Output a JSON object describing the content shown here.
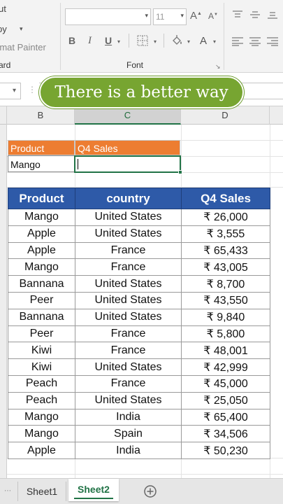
{
  "ribbon": {
    "clipboard": {
      "cut_label": "ut",
      "copy_label": "py",
      "painter_label": "rmat Painter",
      "group_label": "ard"
    },
    "font": {
      "font_name": "",
      "font_size": "11",
      "group_label": "Font",
      "bold_label": "B",
      "italic_label": "I",
      "underline_label": "U",
      "font_color_label": "A",
      "grow_label": "A",
      "shrink_label": "A"
    }
  },
  "formula_bar": {
    "name_box": "",
    "value": ""
  },
  "banner": {
    "text": "There is a better way",
    "color": "#77a531"
  },
  "columns": [
    "B",
    "C",
    "D"
  ],
  "lookup": {
    "header_product": "Product",
    "header_sales": "Q4 Sales",
    "product_value": "Mango",
    "sales_value": "",
    "header_color": "#ed7d31"
  },
  "table": {
    "header_color": "#2e5aa8",
    "headers": [
      "Product",
      "country",
      "Q4 Sales"
    ],
    "rows": [
      [
        "Mango",
        "United States",
        "₹ 26,000"
      ],
      [
        "Apple",
        "United States",
        "₹ 3,555"
      ],
      [
        "Apple",
        "France",
        "₹ 65,433"
      ],
      [
        "Mango",
        "France",
        "₹ 43,005"
      ],
      [
        "Bannana",
        "United States",
        "₹ 8,700"
      ],
      [
        "Peer",
        "United States",
        "₹ 43,550"
      ],
      [
        "Bannana",
        "United States",
        "₹ 9,840"
      ],
      [
        "Peer",
        "France",
        "₹ 5,800"
      ],
      [
        "Kiwi",
        "France",
        "₹ 48,001"
      ],
      [
        "Kiwi",
        "United States",
        "₹ 42,999"
      ],
      [
        "Peach",
        "France",
        "₹ 45,000"
      ],
      [
        "Peach",
        "United States",
        "₹ 25,050"
      ],
      [
        "Mango",
        "India",
        "₹ 65,400"
      ],
      [
        "Mango",
        "Spain",
        "₹ 34,506"
      ],
      [
        "Apple",
        "India",
        "₹ 50,230"
      ]
    ]
  },
  "sheet_tabs": [
    {
      "label": "Sheet1",
      "active": false
    },
    {
      "label": "Sheet2",
      "active": true
    }
  ],
  "accent_color": "#217346"
}
